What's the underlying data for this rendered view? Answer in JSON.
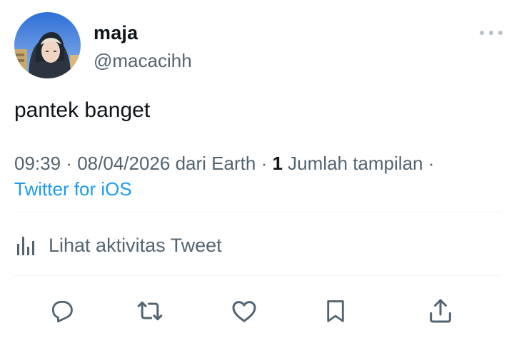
{
  "tweet": {
    "author": {
      "name": "maja",
      "handle": "@macacihh",
      "avatar_icon": "profile-photo"
    },
    "text": "pantek banget",
    "meta": {
      "time": "09:39",
      "separator": "·",
      "date": "08/04/2026",
      "from_label": "dari Earth",
      "views_count": "1",
      "views_label": "Jumlah tampilan",
      "source": "Twitter for iOS"
    },
    "activity_label": "Lihat aktivitas Tweet",
    "actions": [
      {
        "name": "reply",
        "icon": "reply-icon"
      },
      {
        "name": "retweet",
        "icon": "retweet-icon"
      },
      {
        "name": "like",
        "icon": "heart-icon"
      },
      {
        "name": "bookmark",
        "icon": "bookmark-icon"
      },
      {
        "name": "share",
        "icon": "share-icon"
      }
    ]
  },
  "colors": {
    "text_primary": "#0f1419",
    "text_secondary": "#536471",
    "link_blue": "#1d9bf0",
    "divider": "#eff3f4",
    "more_dots": "#b7c0c8"
  }
}
